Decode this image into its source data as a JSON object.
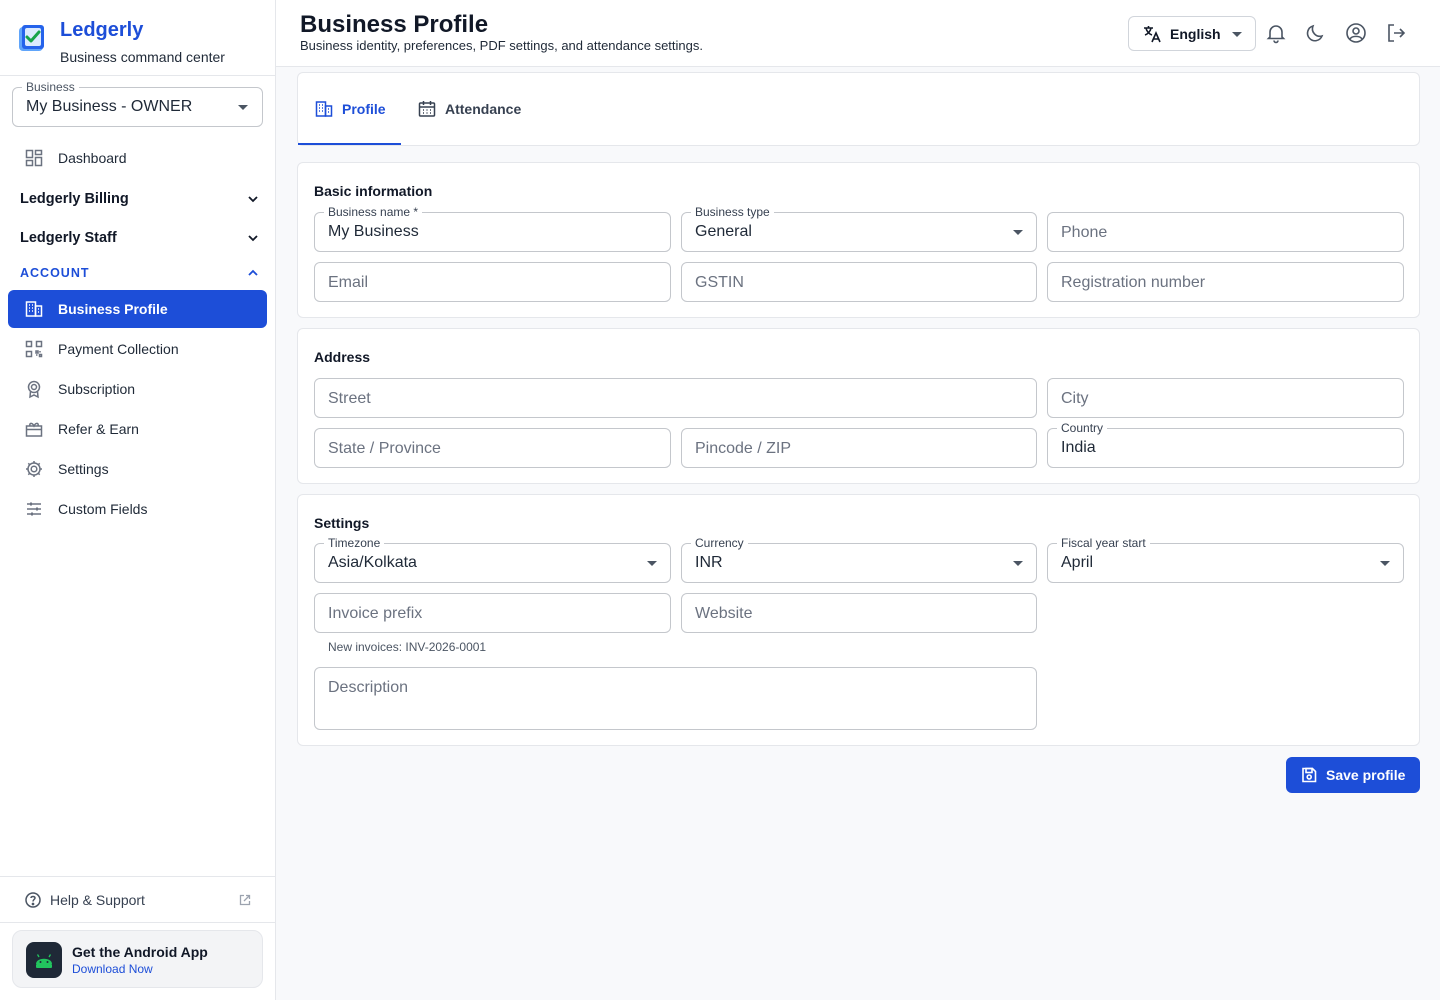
{
  "brand": {
    "name": "Ledgerly",
    "tagline": "Business command center"
  },
  "business_select": {
    "label": "Business",
    "value": "My Business - OWNER"
  },
  "nav": {
    "dashboard": "Dashboard",
    "group_billing": "Ledgerly Billing",
    "group_staff": "Ledgerly Staff",
    "section_account": "ACCOUNT",
    "items": [
      {
        "label": "Business Profile",
        "icon": "building-icon",
        "active": true
      },
      {
        "label": "Payment Collection",
        "icon": "qr-code-icon"
      },
      {
        "label": "Subscription",
        "icon": "badge-icon"
      },
      {
        "label": "Refer & Earn",
        "icon": "gift-icon"
      },
      {
        "label": "Settings",
        "icon": "gear-icon"
      },
      {
        "label": "Custom Fields",
        "icon": "sliders-icon"
      }
    ],
    "help": "Help & Support"
  },
  "app_promo": {
    "title": "Get the Android App",
    "link": "Download Now"
  },
  "header": {
    "title": "Business Profile",
    "subtitle": "Business identity, preferences, PDF settings, and attendance settings.",
    "language": "English"
  },
  "tabs": [
    {
      "label": "Profile",
      "active": true
    },
    {
      "label": "Attendance"
    }
  ],
  "basic": {
    "title": "Basic information",
    "business_name": {
      "label": "Business name *",
      "value": "My Business"
    },
    "business_type": {
      "label": "Business type",
      "value": "General"
    },
    "phone": "Phone",
    "email": "Email",
    "gstin": "GSTIN",
    "registration": "Registration number"
  },
  "address": {
    "title": "Address",
    "street": "Street",
    "city": "City",
    "state": "State / Province",
    "pincode": "Pincode / ZIP",
    "country": {
      "label": "Country",
      "value": "India"
    }
  },
  "settings": {
    "title": "Settings",
    "timezone": {
      "label": "Timezone",
      "value": "Asia/Kolkata"
    },
    "currency": {
      "label": "Currency",
      "value": "INR"
    },
    "fiscal": {
      "label": "Fiscal year start",
      "value": "April"
    },
    "invoice_prefix": "Invoice prefix",
    "invoice_helper": "New invoices: INV-2026-0001",
    "website": "Website",
    "description": "Description"
  },
  "actions": {
    "save": "Save profile"
  },
  "colors": {
    "accent": "#1d4ed8",
    "border": "#c4c7cc"
  }
}
